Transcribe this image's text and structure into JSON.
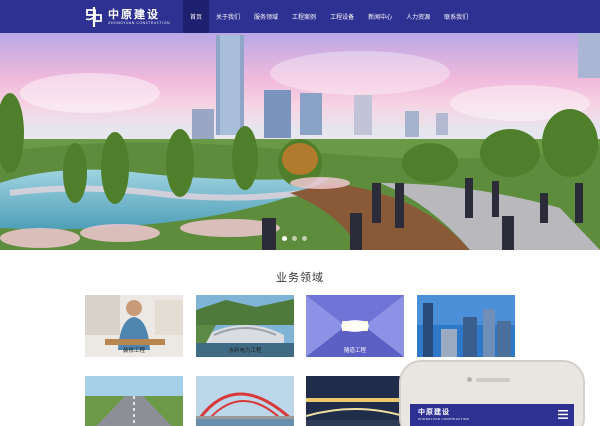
{
  "header": {
    "logo": {
      "name_cn": "中原建设",
      "name_en": "ZHONGYUAN CONSTRUCTION",
      "icon": "zhongyuan-logo-icon"
    },
    "nav": [
      {
        "label": "首页",
        "active": true
      },
      {
        "label": "关于我们",
        "active": false
      },
      {
        "label": "服务领域",
        "active": false
      },
      {
        "label": "工程案例",
        "active": false
      },
      {
        "label": "工程设备",
        "active": false
      },
      {
        "label": "新闻中心",
        "active": false
      },
      {
        "label": "人力资源",
        "active": false
      },
      {
        "label": "联系我们",
        "active": false
      }
    ]
  },
  "banner": {
    "slides": 3,
    "active_slide": 1
  },
  "section": {
    "title": "业务领域",
    "cards": [
      {
        "label": "装修工程"
      },
      {
        "label": "水利电力工程"
      },
      {
        "label": "隧道工程"
      },
      {
        "label": ""
      },
      {
        "label": ""
      },
      {
        "label": ""
      },
      {
        "label": ""
      }
    ]
  },
  "phone": {
    "logo_cn": "中原建设",
    "logo_en": "ZHONGYUAN CONSTRUCTION",
    "menu_icon": "hamburger-icon"
  },
  "colors": {
    "brand": "#2e3192",
    "brand_dark": "#1e1f6e"
  }
}
